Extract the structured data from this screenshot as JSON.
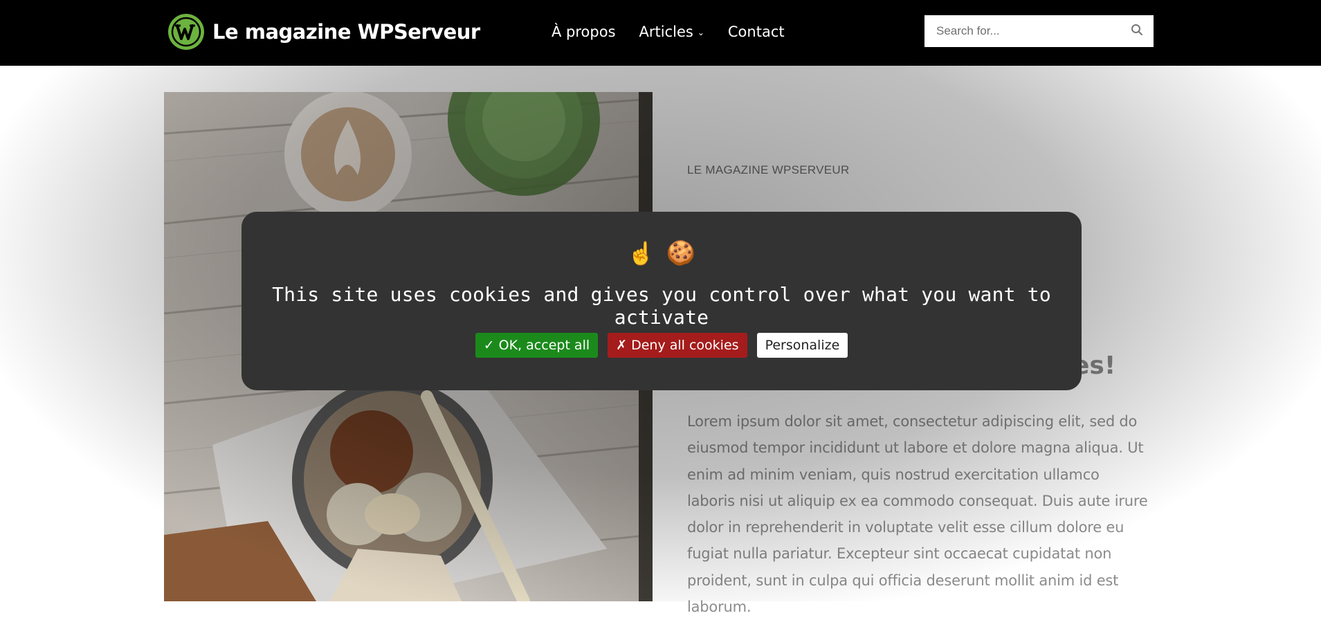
{
  "header": {
    "site_title": "Le magazine WPServeur",
    "nav": [
      {
        "label": "À propos"
      },
      {
        "label": "Articles",
        "has_dropdown": true
      },
      {
        "label": "Contact"
      }
    ],
    "search": {
      "placeholder": "Search for..."
    }
  },
  "main": {
    "eyebrow": "LE MAGAZINE WPSERVEUR",
    "headline_visible_fragment": "es!",
    "body": "Lorem ipsum dolor sit amet, consectetur adipiscing elit, sed do eiusmod tempor incididunt ut labore et dolore magna aliqua. Ut enim ad minim veniam, quis nostrud exercitation ullamco laboris nisi ut aliquip ex ea commodo consequat. Duis aute irure dolor in reprehenderit in voluptate velit esse cillum dolore eu fugiat nulla pariatur. Excepteur sint occaecat cupidatat non proident, sunt in culpa qui officia deserunt mollit anim id est laborum."
  },
  "cookie_banner": {
    "emoji_pointer": "☝",
    "emoji_cookie": "🍪",
    "message": "This site uses cookies and gives you control over what you want to activate",
    "accept_label": "✓ OK, accept all",
    "deny_label": "✗ Deny all cookies",
    "personalize_label": "Personalize"
  },
  "colors": {
    "header_bg": "#000000",
    "logo_green": "#6db33f",
    "banner_bg": "#333333",
    "accept_green": "#1b8a1b",
    "deny_red": "#a51c1c"
  }
}
